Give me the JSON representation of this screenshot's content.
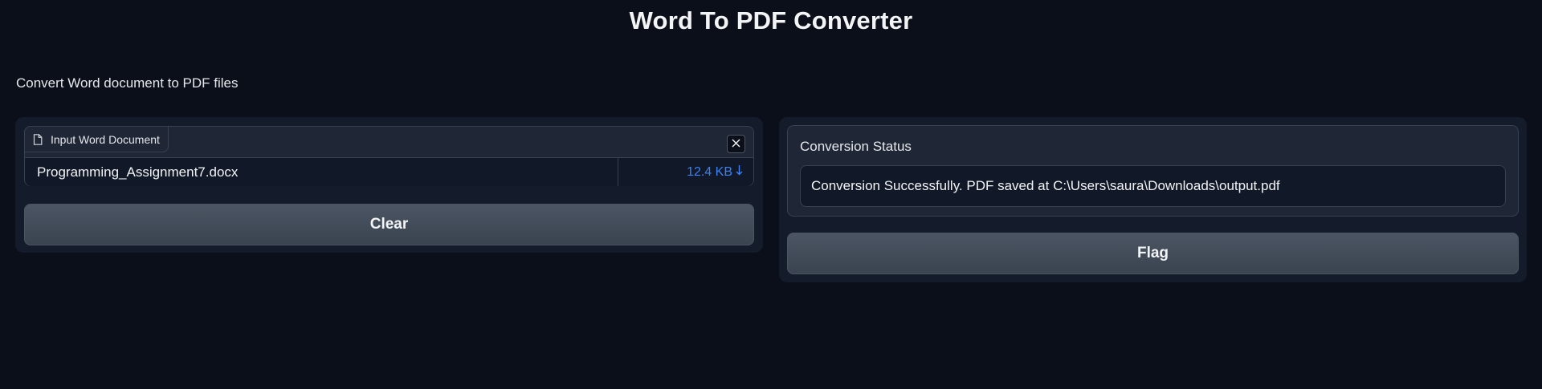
{
  "app": {
    "title": "Word To PDF Converter",
    "description": "Convert Word document to PDF files"
  },
  "input": {
    "label": "Input Word Document",
    "file_name": "Programming_Assignment7.docx",
    "file_size": "12.4 KB",
    "clear_label": "Clear"
  },
  "output": {
    "label": "Conversion Status",
    "value": "Conversion Successfully. PDF saved at C:\\Users\\saura\\Downloads\\output.pdf",
    "flag_label": "Flag"
  },
  "colors": {
    "background": "#0b0f19",
    "panel": "#141b2a",
    "link": "#3b82f6"
  },
  "icons": {
    "file_label_icon": "file-icon",
    "clear_file_icon": "close-icon",
    "download_icon": "download-arrow-icon"
  }
}
